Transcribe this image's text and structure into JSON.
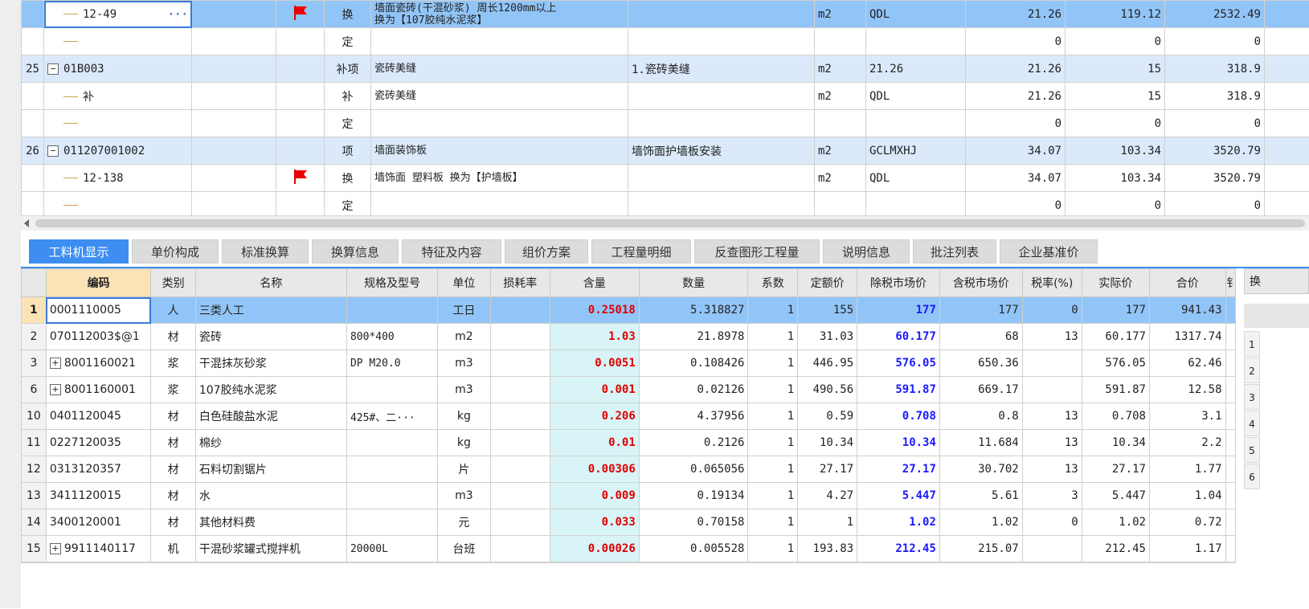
{
  "upper_rows": [
    {
      "num": "",
      "code": "12-49",
      "flag": true,
      "type": "换",
      "name": "墙面瓷砖(干混砂浆) 周长1200mm以上\n换为【107胶纯水泥浆】",
      "feature": "",
      "unit": "m2",
      "expr": "QDL",
      "qty": "21.26",
      "price": "119.12",
      "total": "2532.49",
      "style": "blue",
      "level": 1,
      "selected": true
    },
    {
      "num": "",
      "code": "",
      "flag": false,
      "type": "定",
      "name": "",
      "feature": "",
      "unit": "",
      "expr": "",
      "qty": "0",
      "price": "0",
      "total": "0",
      "style": "white",
      "level": 1
    },
    {
      "num": "25",
      "code": "01B003",
      "flag": false,
      "type": "补项",
      "name": "瓷砖美缝",
      "feature": "1.瓷砖美缝",
      "unit": "m2",
      "expr": "21.26",
      "qty": "21.26",
      "price": "15",
      "total": "318.9",
      "style": "light",
      "level": 0
    },
    {
      "num": "",
      "code": "补",
      "flag": false,
      "type": "补",
      "name": "瓷砖美缝",
      "feature": "",
      "unit": "m2",
      "expr": "QDL",
      "qty": "21.26",
      "price": "15",
      "total": "318.9",
      "style": "white",
      "level": 1
    },
    {
      "num": "",
      "code": "",
      "flag": false,
      "type": "定",
      "name": "",
      "feature": "",
      "unit": "",
      "expr": "",
      "qty": "0",
      "price": "0",
      "total": "0",
      "style": "white",
      "level": 1
    },
    {
      "num": "26",
      "code": "011207001002",
      "flag": false,
      "type": "项",
      "name": "墙面装饰板",
      "feature": "墙饰面护墙板安装",
      "unit": "m2",
      "expr": "GCLMXHJ",
      "qty": "34.07",
      "price": "103.34",
      "total": "3520.79",
      "style": "light",
      "level": 0
    },
    {
      "num": "",
      "code": "12-138",
      "flag": true,
      "type": "换",
      "name": "墙饰面 塑料板  换为【护墙板】",
      "feature": "",
      "unit": "m2",
      "expr": "QDL",
      "qty": "34.07",
      "price": "103.34",
      "total": "3520.79",
      "style": "white",
      "level": 1
    },
    {
      "num": "",
      "code": "",
      "flag": false,
      "type": "定",
      "name": "",
      "feature": "",
      "unit": "",
      "expr": "",
      "qty": "0",
      "price": "0",
      "total": "0",
      "style": "white",
      "level": 1
    }
  ],
  "tabs": [
    "工料机显示",
    "单价构成",
    "标准换算",
    "换算信息",
    "特征及内容",
    "组价方案",
    "工程量明细",
    "反查图形工程量",
    "说明信息",
    "批注列表",
    "企业基准价"
  ],
  "active_tab": 0,
  "lower_headers": [
    "编码",
    "类别",
    "名称",
    "规格及型号",
    "单位",
    "损耗率",
    "含量",
    "数量",
    "系数",
    "定额价",
    "除税市场价",
    "含税市场价",
    "税率(%)",
    "实际价",
    "合价",
    "钅"
  ],
  "lower_rows": [
    {
      "row": "1",
      "code": "0001110005",
      "expand": false,
      "cat": "人",
      "name": "三类人工",
      "spec": "",
      "unit": "工日",
      "loss": "",
      "content": "0.25018",
      "quantity": "5.318827",
      "coef": "1",
      "base": "155",
      "notax": "177",
      "withtax": "177",
      "rate": "0",
      "actual": "177",
      "total": "941.43"
    },
    {
      "row": "2",
      "code": "070112003$@1",
      "expand": false,
      "cat": "材",
      "name": "瓷砖",
      "spec": "800*400",
      "unit": "m2",
      "loss": "",
      "content": "1.03",
      "quantity": "21.8978",
      "coef": "1",
      "base": "31.03",
      "notax": "60.177",
      "withtax": "68",
      "rate": "13",
      "actual": "60.177",
      "total": "1317.74"
    },
    {
      "row": "3",
      "code": "8001160021",
      "expand": true,
      "cat": "浆",
      "name": "干混抹灰砂浆",
      "spec": "DP M20.0",
      "unit": "m3",
      "loss": "",
      "content": "0.0051",
      "quantity": "0.108426",
      "coef": "1",
      "base": "446.95",
      "notax": "576.05",
      "withtax": "650.36",
      "rate": "",
      "actual": "576.05",
      "total": "62.46"
    },
    {
      "row": "6",
      "code": "8001160001",
      "expand": true,
      "cat": "浆",
      "name": "107胶纯水泥浆",
      "spec": "",
      "unit": "m3",
      "loss": "",
      "content": "0.001",
      "quantity": "0.02126",
      "coef": "1",
      "base": "490.56",
      "notax": "591.87",
      "withtax": "669.17",
      "rate": "",
      "actual": "591.87",
      "total": "12.58"
    },
    {
      "row": "10",
      "code": "0401120045",
      "expand": false,
      "cat": "材",
      "name": "白色硅酸盐水泥",
      "spec": "425#、二···",
      "unit": "kg",
      "loss": "",
      "content": "0.206",
      "quantity": "4.37956",
      "coef": "1",
      "base": "0.59",
      "notax": "0.708",
      "withtax": "0.8",
      "rate": "13",
      "actual": "0.708",
      "total": "3.1"
    },
    {
      "row": "11",
      "code": "0227120035",
      "expand": false,
      "cat": "材",
      "name": "棉纱",
      "spec": "",
      "unit": "kg",
      "loss": "",
      "content": "0.01",
      "quantity": "0.2126",
      "coef": "1",
      "base": "10.34",
      "notax": "10.34",
      "withtax": "11.684",
      "rate": "13",
      "actual": "10.34",
      "total": "2.2"
    },
    {
      "row": "12",
      "code": "0313120357",
      "expand": false,
      "cat": "材",
      "name": "石料切割锯片",
      "spec": "",
      "unit": "片",
      "loss": "",
      "content": "0.00306",
      "quantity": "0.065056",
      "coef": "1",
      "base": "27.17",
      "notax": "27.17",
      "withtax": "30.702",
      "rate": "13",
      "actual": "27.17",
      "total": "1.77"
    },
    {
      "row": "13",
      "code": "3411120015",
      "expand": false,
      "cat": "材",
      "name": "水",
      "spec": "",
      "unit": "m3",
      "loss": "",
      "content": "0.009",
      "quantity": "0.19134",
      "coef": "1",
      "base": "4.27",
      "notax": "5.447",
      "withtax": "5.61",
      "rate": "3",
      "actual": "5.447",
      "total": "1.04"
    },
    {
      "row": "14",
      "code": "3400120001",
      "expand": false,
      "cat": "材",
      "name": "其他材料费",
      "spec": "",
      "unit": "元",
      "loss": "",
      "content": "0.033",
      "quantity": "0.70158",
      "coef": "1",
      "base": "1",
      "notax": "1.02",
      "withtax": "1.02",
      "rate": "0",
      "actual": "1.02",
      "total": "0.72"
    },
    {
      "row": "15",
      "code": "9911140117",
      "expand": true,
      "cat": "机",
      "name": "干混砂浆罐式搅拌机",
      "spec": "20000L",
      "unit": "台班",
      "loss": "",
      "content": "0.00026",
      "quantity": "0.005528",
      "coef": "1",
      "base": "193.83",
      "notax": "212.45",
      "withtax": "215.07",
      "rate": "",
      "actual": "212.45",
      "total": "1.17"
    }
  ],
  "right_panel": {
    "header": "换",
    "rows": [
      "1",
      "2",
      "3",
      "4",
      "5",
      "6"
    ]
  },
  "colors": {
    "selected_row": "#92c5f7",
    "light_row": "#dbe9fb",
    "tab_active": "#3d8ef0",
    "content_red": "#e00000",
    "price_blue": "#1a1aff"
  }
}
